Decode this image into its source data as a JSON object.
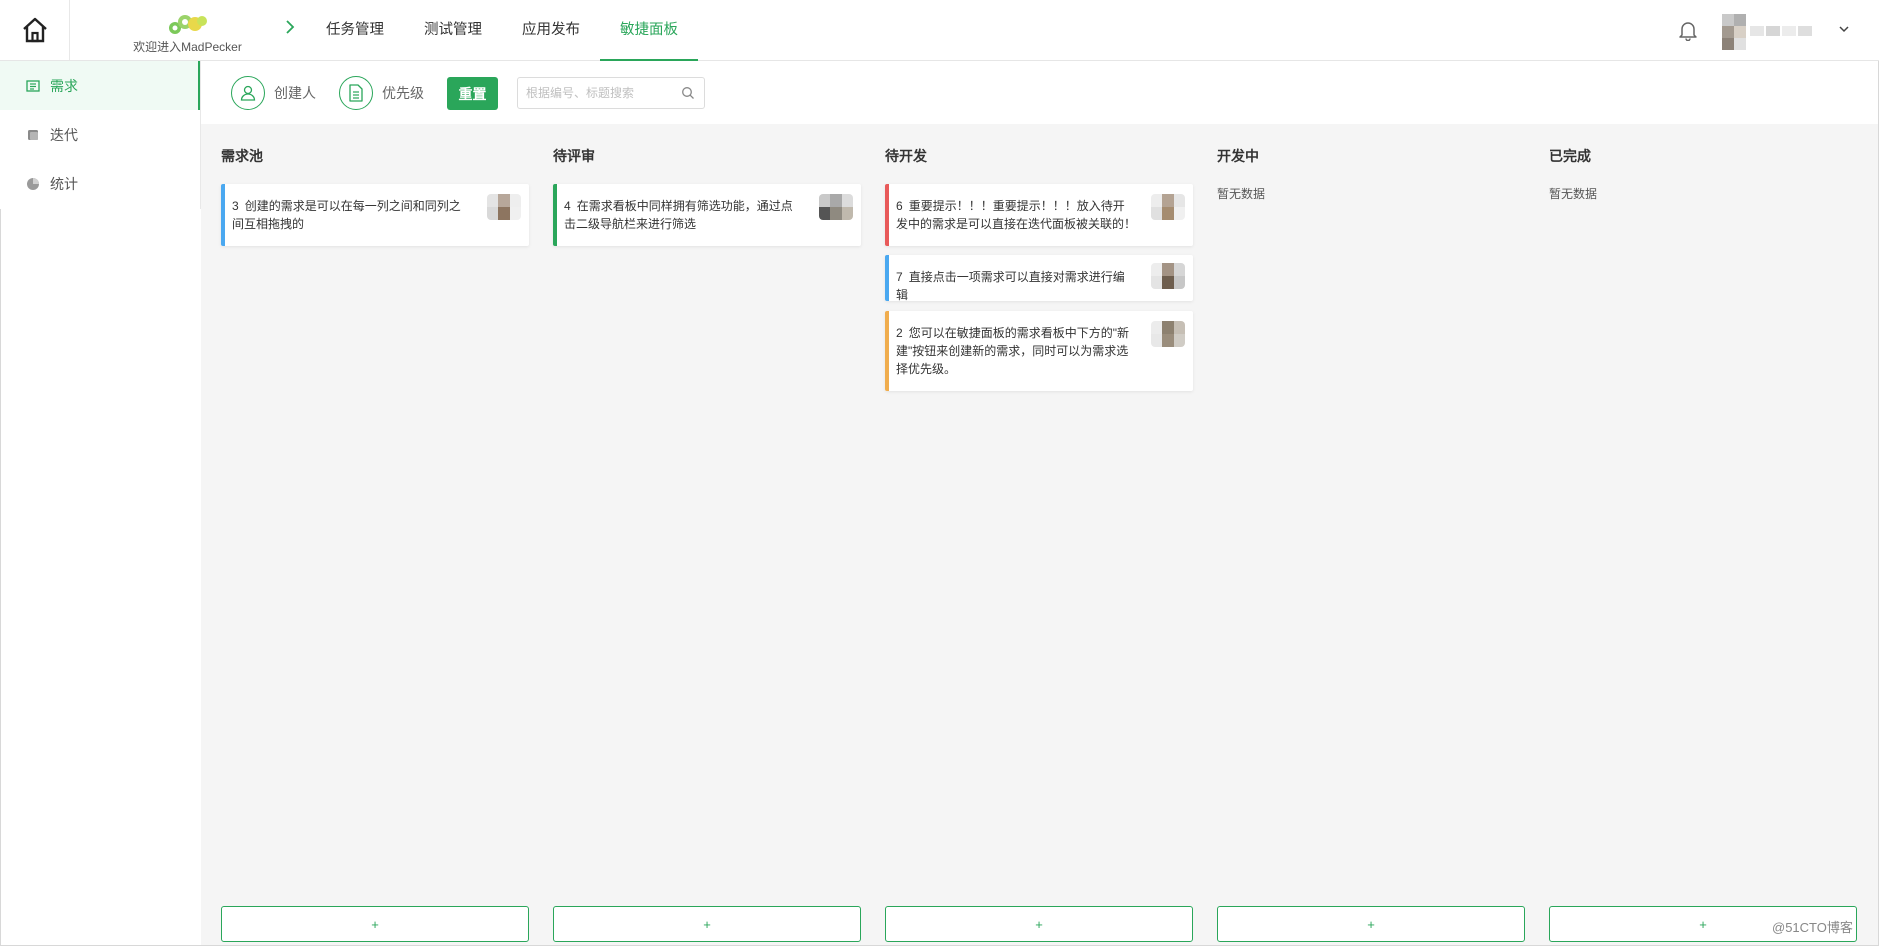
{
  "header": {
    "welcome": "欢迎进入MadPecker",
    "nav": [
      "任务管理",
      "测试管理",
      "应用发布",
      "敏捷面板"
    ],
    "active_nav_index": 3
  },
  "sidebar": {
    "items": [
      {
        "label": "需求",
        "icon": "requirement-icon",
        "active": true
      },
      {
        "label": "迭代",
        "icon": "iteration-icon",
        "active": false
      },
      {
        "label": "统计",
        "icon": "pie-chart-icon",
        "active": false
      }
    ]
  },
  "toolbar": {
    "creator_label": "创建人",
    "priority_label": "优先级",
    "reset_label": "重置",
    "search_placeholder": "根据编号、标题搜索"
  },
  "board": {
    "empty_text": "暂无数据",
    "add_label": "+",
    "columns": [
      {
        "title": "需求池",
        "cards": [
          {
            "id": "3",
            "text": "创建的需求是可以在每一列之间和同列之间互相拖拽的",
            "color": "#4aa8f0"
          }
        ]
      },
      {
        "title": "待评审",
        "cards": [
          {
            "id": "4",
            "text": "在需求看板中同样拥有筛选功能，通过点击二级导航栏来进行筛选",
            "color": "#2aa65a"
          }
        ]
      },
      {
        "title": "待开发",
        "cards": [
          {
            "id": "6",
            "text": "重要提示！！！重要提示！！！放入待开发中的需求是可以直接在迭代面板被关联的！",
            "color": "#e85a5a"
          },
          {
            "id": "7",
            "text": "直接点击一项需求可以直接对需求进行编辑",
            "color": "#4aa8f0"
          },
          {
            "id": "2",
            "text": "您可以在敏捷面板的需求看板中下方的\"新建\"按钮来创建新的需求，同时可以为需求选择优先级。",
            "color": "#f0ad4e"
          }
        ]
      },
      {
        "title": "开发中",
        "cards": []
      },
      {
        "title": "已完成",
        "cards": []
      }
    ]
  },
  "watermark": "@51CTO博客",
  "colors": {
    "accent": "#2aa65a",
    "board_bg": "#f5f5f5"
  }
}
